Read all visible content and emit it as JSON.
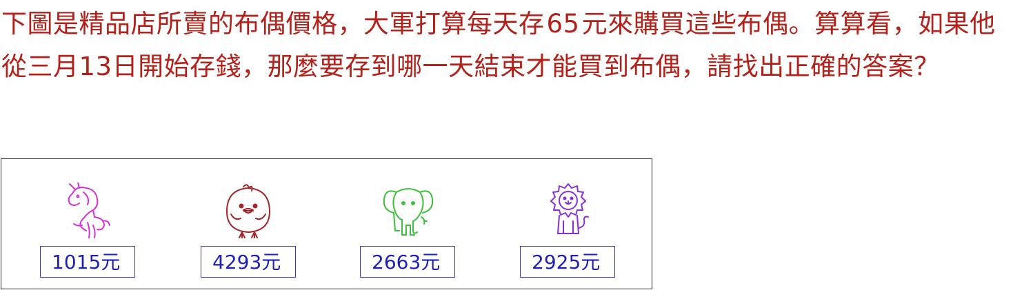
{
  "question": {
    "part1": "下圖是精品店所賣的布偶價格，大軍打算每天存",
    "daily_amount": "65",
    "part2": "元來購買這些布偶。算算看，如果他從三月",
    "start_day": "13",
    "part3": "日開始存錢，那麼要存到哪一天結束才能買到布偶，請找出正確的答案？"
  },
  "items": [
    {
      "animal": "unicorn",
      "price": "1015元",
      "color": "#d633d6"
    },
    {
      "animal": "chick",
      "price": "4293元",
      "color": "#a3272a"
    },
    {
      "animal": "elephant",
      "price": "2663元",
      "color": "#3cbf3c"
    },
    {
      "animal": "lion",
      "price": "2925元",
      "color": "#8a2fd6"
    }
  ]
}
